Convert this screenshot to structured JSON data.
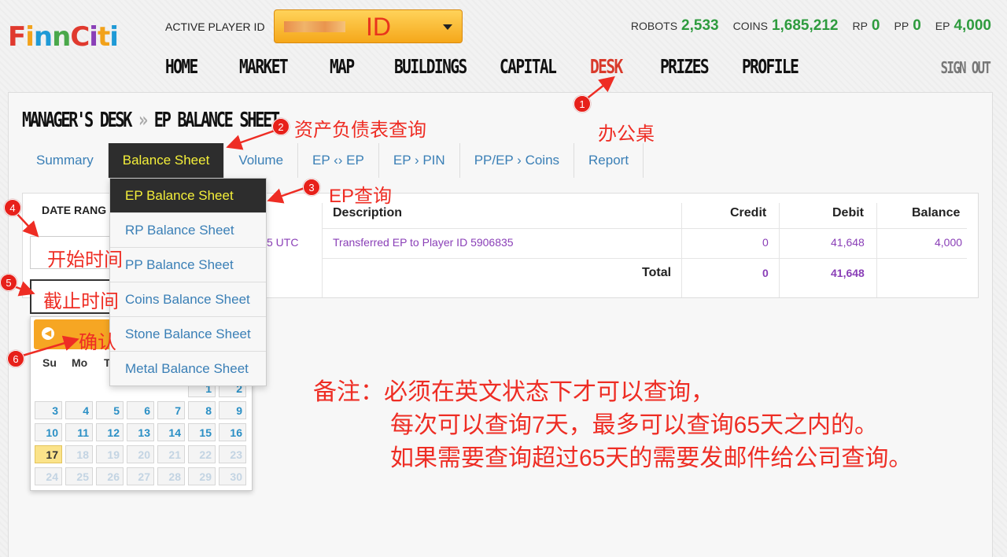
{
  "header": {
    "logo_text": "FinnCiti",
    "logo_letters": [
      "F",
      "i",
      "n",
      "n",
      "C",
      "i",
      "t",
      "i"
    ],
    "logo_colors": [
      "#e0392e",
      "#f2a21b",
      "#1f9ad6",
      "#4aa84a",
      "#e0392e",
      "#8a3fb7",
      "#f2a21b",
      "#1f9ad6"
    ],
    "player_id_label": "ACTIVE PLAYER ID",
    "player_id_value": "ID",
    "stats": [
      {
        "label": "ROBOTS",
        "value": "2,533"
      },
      {
        "label": "COINS",
        "value": "1,685,212"
      },
      {
        "label": "RP",
        "value": "0"
      },
      {
        "label": "PP",
        "value": "0"
      },
      {
        "label": "EP",
        "value": "4,000"
      }
    ],
    "nav": [
      "HOME",
      "MARKET",
      "MAP",
      "BUILDINGS",
      "CAPITAL",
      "DESK",
      "PRIZES",
      "PROFILE"
    ],
    "active_nav": "DESK",
    "sign_out": "SIGN OUT"
  },
  "page": {
    "title_part1": "MANAGER'S DESK",
    "title_sep": "»",
    "title_part2": "EP BALANCE SHEET"
  },
  "tabs": [
    "Summary",
    "Balance Sheet",
    "Volume",
    "EP ‹› EP",
    "EP › PIN",
    "PP/EP › Coins",
    "Report"
  ],
  "active_tab": "Balance Sheet",
  "dropdown": [
    "EP Balance Sheet",
    "RP Balance Sheet",
    "PP Balance Sheet",
    "Coins Balance Sheet",
    "Stone Balance Sheet",
    "Metal Balance Sheet"
  ],
  "date_range_label": "DATE RANG",
  "table": {
    "headers": {
      "description": "Description",
      "credit": "Credit",
      "debit": "Debit",
      "balance": "Balance"
    },
    "row": {
      "date_fragment": "5 UTC",
      "description": "Transferred EP to Player ID 5906835",
      "credit": "0",
      "debit": "41,648",
      "balance": "4,000"
    },
    "total": {
      "label": "Total",
      "credit": "0",
      "debit": "41,648"
    }
  },
  "calendar": {
    "weekdays": [
      "Su",
      "Mo",
      "T"
    ],
    "weeks": [
      [
        "",
        "",
        "",
        "",
        "",
        "1",
        "2"
      ],
      [
        "3",
        "4",
        "5",
        "6",
        "7",
        "8",
        "9"
      ],
      [
        "10",
        "11",
        "12",
        "13",
        "14",
        "15",
        "16"
      ],
      [
        "17",
        "18",
        "19",
        "20",
        "21",
        "22",
        "23"
      ],
      [
        "24",
        "25",
        "26",
        "27",
        "28",
        "29",
        "30"
      ]
    ],
    "today": "17"
  },
  "annotations": {
    "a1": "办公桌",
    "a2": "资产负债表查询",
    "a3": "EP查询",
    "a4": "开始时间",
    "a5": "截止时间",
    "a6": "确认",
    "badges": [
      "1",
      "2",
      "3",
      "4",
      "5",
      "6"
    ],
    "note_line1": "备注：必须在英文状态下才可以查询，",
    "note_line2": "每次可以查询7天，最多可以查询65天之内的。",
    "note_line3": "如果需要查询超过65天的需要发邮件给公司查询。"
  },
  "colors": {
    "accent_green": "#2e9b3e",
    "active_red": "#d93a2b",
    "link_blue": "#3a7fb6",
    "purple": "#8a3fb7",
    "annotation_red": "#ee2d24",
    "tab_active_text": "#f4ef3a"
  }
}
